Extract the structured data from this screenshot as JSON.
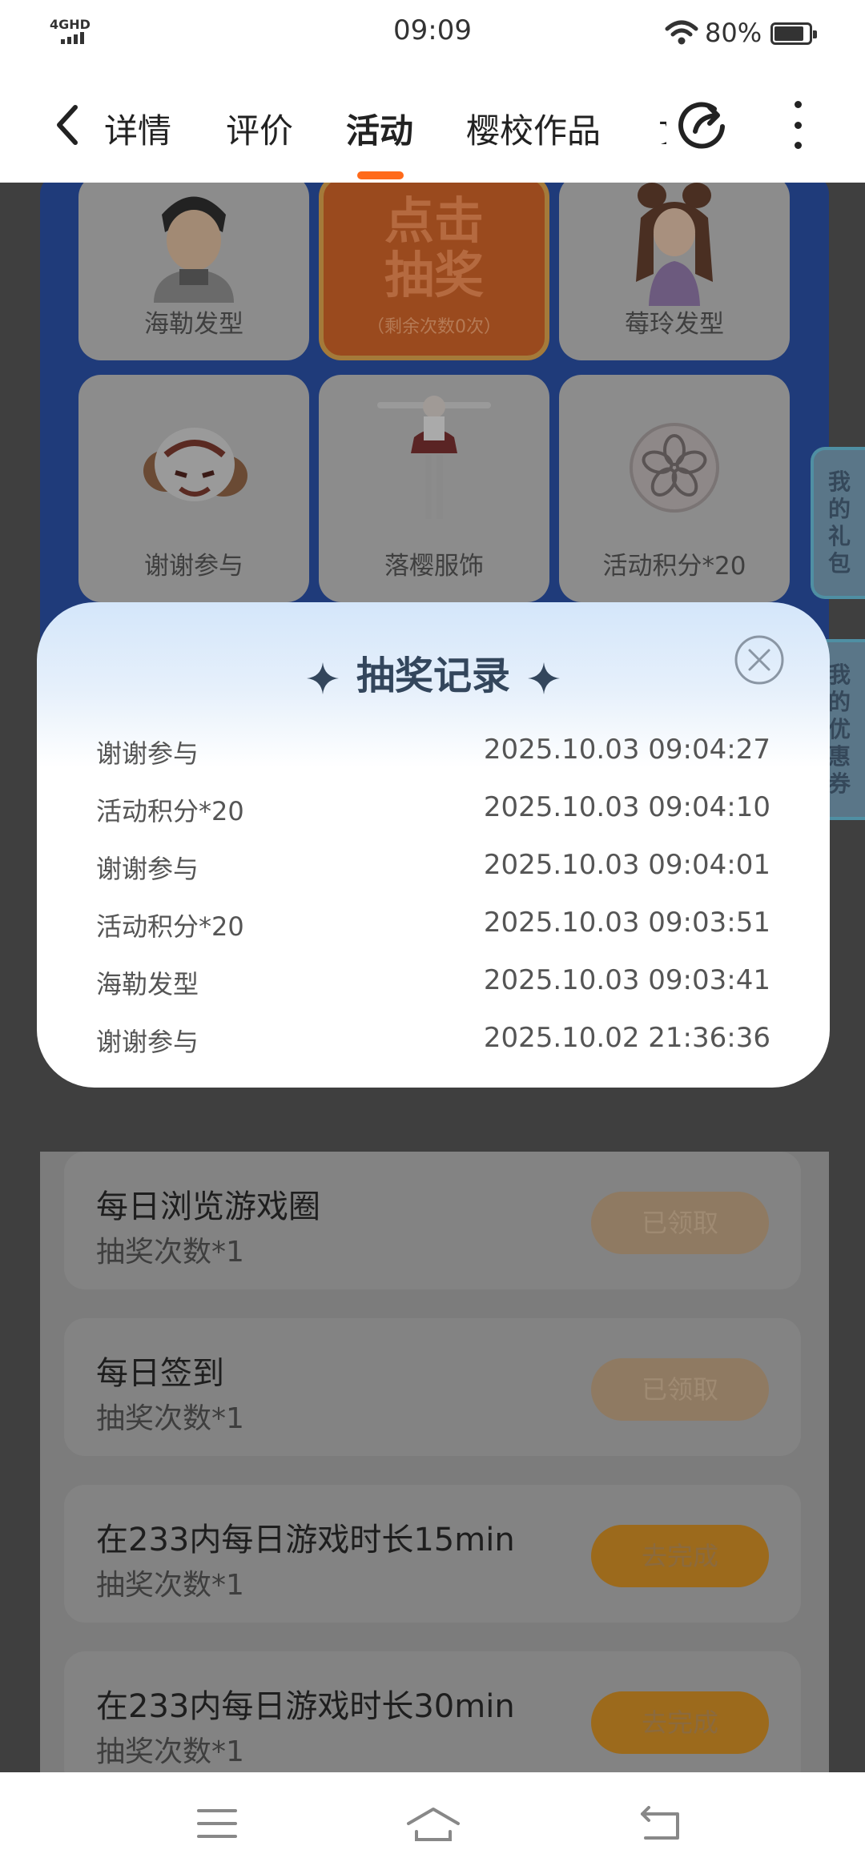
{
  "status": {
    "network": "4GHD",
    "time": "09:09",
    "battery": "80%"
  },
  "nav": {
    "tabs": [
      {
        "label": "详情"
      },
      {
        "label": "评价"
      },
      {
        "label": "活动"
      },
      {
        "label": "樱校作品"
      }
    ],
    "active_tab": "活动"
  },
  "lottery": {
    "items": [
      {
        "label": "海勒发型",
        "icon": "boy-avatar"
      },
      {
        "label": "莓玲发型",
        "icon": "girl-avatar"
      },
      {
        "label": "谢谢参与",
        "icon": "sheep-avatar"
      },
      {
        "label": "落樱服饰",
        "icon": "outfit-figure"
      },
      {
        "label": "活动积分*20",
        "icon": "sakura-coin"
      }
    ],
    "draw_button": {
      "line1": "点击",
      "line2": "抽奖",
      "remaining": "（剩余次数0次）"
    }
  },
  "side_tabs": {
    "gifts": [
      "我",
      "的",
      "礼",
      "包"
    ],
    "coupons": [
      "我",
      "的",
      "优",
      "惠",
      "券"
    ]
  },
  "modal": {
    "title": "抽奖记录",
    "records": [
      {
        "prize": "谢谢参与",
        "time": "2025.10.03 09:04:27"
      },
      {
        "prize": "活动积分*20",
        "time": "2025.10.03 09:04:10"
      },
      {
        "prize": "谢谢参与",
        "time": "2025.10.03 09:04:01"
      },
      {
        "prize": "活动积分*20",
        "time": "2025.10.03 09:03:51"
      },
      {
        "prize": "海勒发型",
        "time": "2025.10.03 09:03:41"
      },
      {
        "prize": "谢谢参与",
        "time": "2025.10.02 21:36:36"
      }
    ]
  },
  "tasks": [
    {
      "name": "每日浏览游戏圈",
      "reward": "抽奖次数*1",
      "button": "已领取"
    },
    {
      "name": "每日签到",
      "reward": "抽奖次数*1",
      "button": "已领取"
    },
    {
      "name": "在233内每日游戏时长15min",
      "reward": "抽奖次数*1",
      "button": "去完成"
    },
    {
      "name": "在233内每日游戏时长30min",
      "reward": "抽奖次数*1",
      "button": "去完成"
    }
  ],
  "colors": {
    "accent": "#ff6a1a",
    "modal_text": "#33465c"
  }
}
